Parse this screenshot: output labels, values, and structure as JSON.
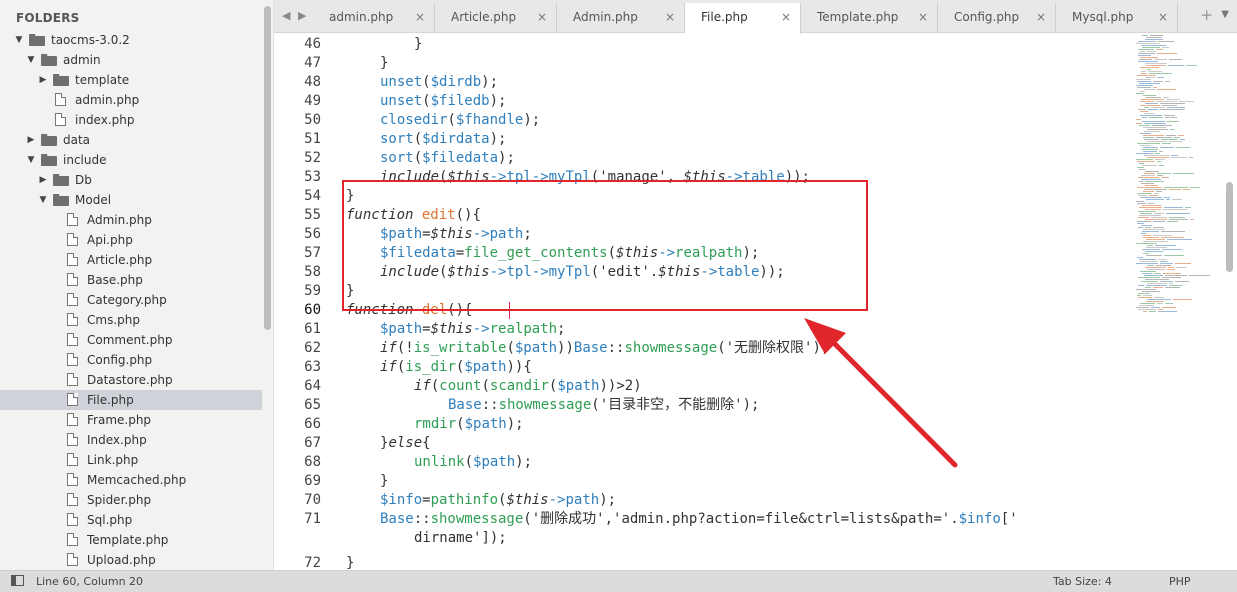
{
  "sidebar": {
    "title": "FOLDERS",
    "tree": [
      {
        "label": "taocms-3.0.2",
        "type": "folder",
        "depth": 0,
        "expanded": true
      },
      {
        "label": "admin",
        "type": "folder",
        "depth": 1,
        "expanded": true
      },
      {
        "label": "template",
        "type": "folder",
        "depth": 2,
        "expanded": false
      },
      {
        "label": "admin.php",
        "type": "file",
        "depth": 2
      },
      {
        "label": "index.php",
        "type": "file",
        "depth": 2
      },
      {
        "label": "data",
        "type": "folder",
        "depth": 1,
        "expanded": false
      },
      {
        "label": "include",
        "type": "folder",
        "depth": 1,
        "expanded": true
      },
      {
        "label": "Db",
        "type": "folder",
        "depth": 2,
        "expanded": false
      },
      {
        "label": "Model",
        "type": "folder",
        "depth": 2,
        "expanded": true
      },
      {
        "label": "Admin.php",
        "type": "file",
        "depth": 3
      },
      {
        "label": "Api.php",
        "type": "file",
        "depth": 3
      },
      {
        "label": "Article.php",
        "type": "file",
        "depth": 3
      },
      {
        "label": "Base.php",
        "type": "file",
        "depth": 3
      },
      {
        "label": "Category.php",
        "type": "file",
        "depth": 3
      },
      {
        "label": "Cms.php",
        "type": "file",
        "depth": 3
      },
      {
        "label": "Comment.php",
        "type": "file",
        "depth": 3
      },
      {
        "label": "Config.php",
        "type": "file",
        "depth": 3
      },
      {
        "label": "Datastore.php",
        "type": "file",
        "depth": 3
      },
      {
        "label": "File.php",
        "type": "file",
        "depth": 3,
        "selected": true
      },
      {
        "label": "Frame.php",
        "type": "file",
        "depth": 3
      },
      {
        "label": "Index.php",
        "type": "file",
        "depth": 3
      },
      {
        "label": "Link.php",
        "type": "file",
        "depth": 3
      },
      {
        "label": "Memcached.php",
        "type": "file",
        "depth": 3
      },
      {
        "label": "Spider.php",
        "type": "file",
        "depth": 3
      },
      {
        "label": "Sql.php",
        "type": "file",
        "depth": 3
      },
      {
        "label": "Template.php",
        "type": "file",
        "depth": 3
      },
      {
        "label": "Upload.php",
        "type": "file",
        "depth": 3
      }
    ]
  },
  "tabs": [
    {
      "label": "admin.php",
      "active": false
    },
    {
      "label": "Article.php",
      "active": false
    },
    {
      "label": "Admin.php",
      "active": false
    },
    {
      "label": "File.php",
      "active": true
    },
    {
      "label": "Template.php",
      "active": false
    },
    {
      "label": "Config.php",
      "active": false
    },
    {
      "label": "Mysql.php",
      "active": false
    }
  ],
  "tab_nav": "◀ ▶",
  "tab_add": "+",
  "tab_menu": "▼",
  "tab_close": "×",
  "colors": {
    "text": "#333333",
    "blue": "#2f7fbd",
    "green": "#2f9e54",
    "orange": "#e0732e",
    "red": "#e0262b",
    "cursor": "#e91e63"
  },
  "code": [
    {
      "n": "46",
      "indent": 2,
      "tokens": [
        [
          "}",
          "#333"
        ]
      ]
    },
    {
      "n": "47",
      "indent": 1,
      "tokens": [
        [
          "}",
          "#333"
        ]
      ]
    },
    {
      "n": "48",
      "indent": 1,
      "tokens": [
        [
          "unset",
          "#2f7fbd"
        ],
        [
          "(",
          "#333"
        ],
        [
          "$dirdb",
          "#2f7fbd"
        ],
        [
          ");",
          "#333"
        ]
      ]
    },
    {
      "n": "49",
      "indent": 1,
      "tokens": [
        [
          "unset",
          "#2f7fbd"
        ],
        [
          "(",
          "#333"
        ],
        [
          "$filedb",
          "#2f7fbd"
        ],
        [
          ");",
          "#333"
        ]
      ]
    },
    {
      "n": "50",
      "indent": 1,
      "tokens": [
        [
          "closedir",
          "#2f7fbd"
        ],
        [
          "(",
          "#333"
        ],
        [
          "$fhandle",
          "#2f7fbd"
        ],
        [
          ");",
          "#333"
        ]
      ]
    },
    {
      "n": "51",
      "indent": 1,
      "tokens": [
        [
          "sort",
          "#2f7fbd"
        ],
        [
          "(",
          "#333"
        ],
        [
          "$dirdata",
          "#2f7fbd"
        ],
        [
          ");",
          "#333"
        ]
      ]
    },
    {
      "n": "52",
      "indent": 1,
      "tokens": [
        [
          "sort",
          "#2f7fbd"
        ],
        [
          "(",
          "#333"
        ],
        [
          "$filedata",
          "#2f7fbd"
        ],
        [
          ");",
          "#333"
        ]
      ]
    },
    {
      "n": "53",
      "indent": 1,
      "tokens": [
        [
          "include",
          "#333",
          "i"
        ],
        [
          "(",
          "#333"
        ],
        [
          "$this",
          "#333",
          "i"
        ],
        [
          "->",
          "#2f7fbd"
        ],
        [
          "tpl",
          "#2f7fbd"
        ],
        [
          "->",
          "#2f7fbd"
        ],
        [
          "myTpl",
          "#2f7fbd"
        ],
        [
          "(",
          "#333"
        ],
        [
          "'manage'",
          "#333"
        ],
        [
          ", ",
          "#333"
        ],
        [
          "$this",
          "#333",
          "i"
        ],
        [
          "->",
          "#2f7fbd"
        ],
        [
          "table",
          "#2f7fbd"
        ],
        [
          "));",
          "#333"
        ]
      ]
    },
    {
      "n": "54",
      "indent": 0,
      "tokens": [
        [
          "}",
          "#333"
        ]
      ]
    },
    {
      "n": "55",
      "indent": 0,
      "tokens": [
        [
          "function",
          "#333",
          "i"
        ],
        [
          " ",
          "#333"
        ],
        [
          "edit",
          "#e0732e"
        ],
        [
          "(){",
          "#333"
        ]
      ]
    },
    {
      "n": "56",
      "indent": 1,
      "tokens": [
        [
          "$path",
          "#2f7fbd"
        ],
        [
          "=",
          "#333"
        ],
        [
          "$this",
          "#333",
          "i"
        ],
        [
          "->",
          "#2f7fbd"
        ],
        [
          "path",
          "#2f7fbd"
        ],
        [
          ";",
          "#333"
        ]
      ]
    },
    {
      "n": "57",
      "indent": 1,
      "tokens": [
        [
          "$filedata",
          "#2f7fbd"
        ],
        [
          "=",
          "#333"
        ],
        [
          "file_get_contents",
          "#2f9e54"
        ],
        [
          "(",
          "#333"
        ],
        [
          "$this",
          "#333",
          "i"
        ],
        [
          "->",
          "#2f7fbd"
        ],
        [
          "realpath",
          "#2f9e54"
        ],
        [
          ");",
          "#333"
        ]
      ]
    },
    {
      "n": "58",
      "indent": 1,
      "tokens": [
        [
          "include",
          "#333",
          "i"
        ],
        [
          "(",
          "#333"
        ],
        [
          "$this",
          "#333",
          "i"
        ],
        [
          "->",
          "#2f7fbd"
        ],
        [
          "tpl",
          "#2f7fbd"
        ],
        [
          "->",
          "#2f7fbd"
        ],
        [
          "myTpl",
          "#2f7fbd"
        ],
        [
          "(",
          "#333"
        ],
        [
          "'edit'",
          "#333"
        ],
        [
          ".",
          "#333"
        ],
        [
          "$this",
          "#333",
          "i"
        ],
        [
          "->",
          "#2f7fbd"
        ],
        [
          "table",
          "#2f7fbd"
        ],
        [
          "));",
          "#333"
        ]
      ]
    },
    {
      "n": "59",
      "indent": 0,
      "tokens": [
        [
          "}",
          "#333"
        ]
      ]
    },
    {
      "n": "60",
      "indent": 0,
      "tokens": [
        [
          "function",
          "#333",
          "i"
        ],
        [
          " ",
          "#333"
        ],
        [
          "del",
          "#e0732e"
        ],
        [
          "(){",
          "#333"
        ]
      ]
    },
    {
      "n": "61",
      "indent": 1,
      "tokens": [
        [
          "$path",
          "#2f7fbd"
        ],
        [
          "=",
          "#333"
        ],
        [
          "$this",
          "#333",
          "i"
        ],
        [
          "->",
          "#2f7fbd"
        ],
        [
          "realpath",
          "#2f9e54"
        ],
        [
          ";",
          "#333"
        ]
      ]
    },
    {
      "n": "62",
      "indent": 1,
      "tokens": [
        [
          "if",
          "#333",
          "i"
        ],
        [
          "(!",
          "#333"
        ],
        [
          "is_writable",
          "#2f9e54"
        ],
        [
          "(",
          "#333"
        ],
        [
          "$path",
          "#2f7fbd"
        ],
        [
          "))",
          "#333"
        ],
        [
          "Base",
          "#2f7fbd"
        ],
        [
          "::",
          "#333"
        ],
        [
          "showmessage",
          "#2f9e54"
        ],
        [
          "(",
          "#333"
        ],
        [
          "'无删除权限'",
          "#333"
        ],
        [
          ");",
          "#333"
        ]
      ]
    },
    {
      "n": "63",
      "indent": 1,
      "tokens": [
        [
          "if",
          "#333",
          "i"
        ],
        [
          "(",
          "#333"
        ],
        [
          "is_dir",
          "#2f9e54"
        ],
        [
          "(",
          "#333"
        ],
        [
          "$path",
          "#2f7fbd"
        ],
        [
          ")){",
          "#333"
        ]
      ]
    },
    {
      "n": "64",
      "indent": 2,
      "tokens": [
        [
          "if",
          "#333",
          "i"
        ],
        [
          "(",
          "#333"
        ],
        [
          "count",
          "#2f9e54"
        ],
        [
          "(",
          "#333"
        ],
        [
          "scandir",
          "#2f9e54"
        ],
        [
          "(",
          "#333"
        ],
        [
          "$path",
          "#2f7fbd"
        ],
        [
          "))>2)",
          "#333"
        ]
      ]
    },
    {
      "n": "65",
      "indent": 3,
      "tokens": [
        [
          "Base",
          "#2f7fbd"
        ],
        [
          "::",
          "#333"
        ],
        [
          "showmessage",
          "#2f9e54"
        ],
        [
          "(",
          "#333"
        ],
        [
          "'目录非空，不能删除'",
          "#333"
        ],
        [
          ");",
          "#333"
        ]
      ]
    },
    {
      "n": "66",
      "indent": 2,
      "tokens": [
        [
          "rmdir",
          "#2f9e54"
        ],
        [
          "(",
          "#333"
        ],
        [
          "$path",
          "#2f7fbd"
        ],
        [
          ");",
          "#333"
        ]
      ]
    },
    {
      "n": "67",
      "indent": 1,
      "tokens": [
        [
          "}",
          "#333"
        ],
        [
          "else",
          "#333",
          "i"
        ],
        [
          "{",
          "#333"
        ]
      ]
    },
    {
      "n": "68",
      "indent": 2,
      "tokens": [
        [
          "unlink",
          "#2f9e54"
        ],
        [
          "(",
          "#333"
        ],
        [
          "$path",
          "#2f7fbd"
        ],
        [
          ");",
          "#333"
        ]
      ]
    },
    {
      "n": "69",
      "indent": 1,
      "tokens": [
        [
          "}",
          "#333"
        ]
      ]
    },
    {
      "n": "70",
      "indent": 1,
      "tokens": [
        [
          "$info",
          "#2f7fbd"
        ],
        [
          "=",
          "#333"
        ],
        [
          "pathinfo",
          "#2f9e54"
        ],
        [
          "(",
          "#333"
        ],
        [
          "$this",
          "#333",
          "i"
        ],
        [
          "->",
          "#2f7fbd"
        ],
        [
          "path",
          "#2f7fbd"
        ],
        [
          ");",
          "#333"
        ]
      ]
    },
    {
      "n": "71",
      "indent": 1,
      "tokens": [
        [
          "Base",
          "#2f7fbd"
        ],
        [
          "::",
          "#333"
        ],
        [
          "showmessage",
          "#2f9e54"
        ],
        [
          "(",
          "#333"
        ],
        [
          "'删除成功'",
          "#333"
        ],
        [
          ",",
          "#333"
        ],
        [
          "'admin.php?action=file&ctrl=lists&path='",
          "#333"
        ],
        [
          ".",
          "#333"
        ],
        [
          "$info",
          "#2f7fbd"
        ],
        [
          "['",
          "#333"
        ]
      ]
    },
    {
      "n": "",
      "indent": 2,
      "tokens": [
        [
          "dirname'",
          "#333"
        ],
        [
          "]);",
          "#333"
        ]
      ]
    },
    {
      "n": "72",
      "indent": 0,
      "tokens": [
        [
          "}",
          "#333"
        ]
      ]
    }
  ],
  "current_line": "60",
  "status": {
    "position": "Line 60, Column 20",
    "tab_size": "Tab Size: 4",
    "syntax": "PHP"
  }
}
